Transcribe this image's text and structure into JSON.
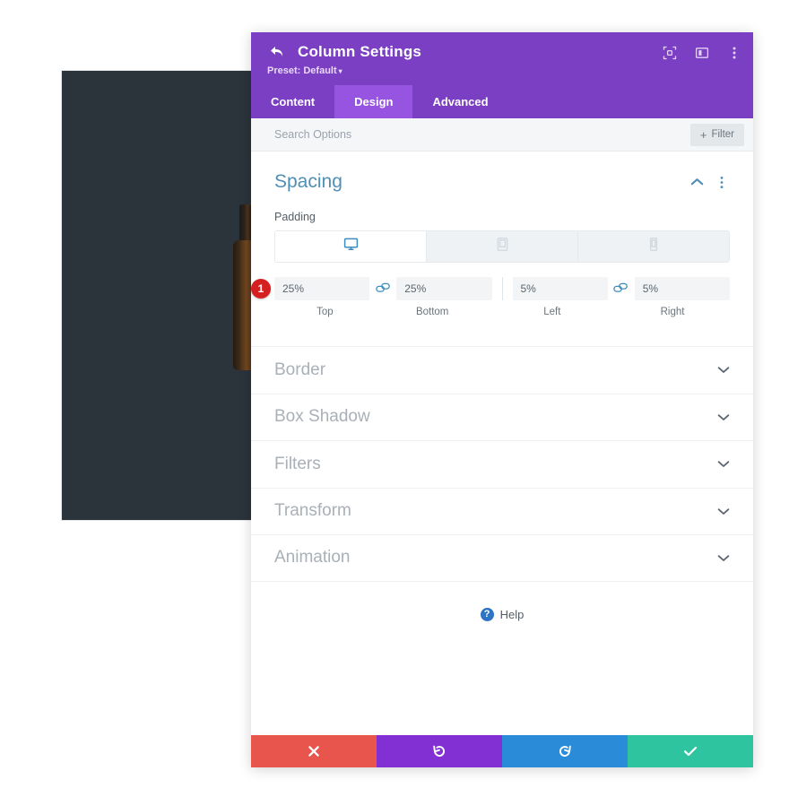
{
  "backdrop": {
    "block_color": "#2b333b",
    "figure_name": "bottle-photo"
  },
  "modal": {
    "title": "Column Settings",
    "preset_label": "Preset: Default",
    "preset_caret": "▾",
    "header_icons": [
      {
        "name": "fullscreen-icon",
        "glyph": "⬚"
      },
      {
        "name": "layout-panel-icon",
        "glyph": "▣"
      },
      {
        "name": "more-vertical-icon",
        "glyph": "⋮"
      }
    ],
    "back_icon": "back-arrow-icon",
    "accent": "#7b3fc4",
    "accent_active": "#9654e0",
    "tabs": [
      {
        "label": "Content",
        "active": false
      },
      {
        "label": "Design",
        "active": true
      },
      {
        "label": "Advanced",
        "active": false
      }
    ]
  },
  "search": {
    "placeholder": "Search Options",
    "value": "",
    "filter_label": "Filter",
    "filter_plus": "+"
  },
  "spacing_section": {
    "title": "Spacing",
    "collapse_icon": "chevron-up-icon",
    "menu_icon": "more-vertical-icon",
    "padding_label": "Padding",
    "devices": [
      {
        "name": "desktop",
        "glyph": "Ὓ5",
        "active": true
      },
      {
        "name": "tablet",
        "glyph": "□",
        "active": false
      },
      {
        "name": "phone",
        "glyph": "▯",
        "active": false
      }
    ],
    "step_badge": "1",
    "fields": [
      {
        "key": "top",
        "value": "25%",
        "label": "Top"
      },
      {
        "key": "bottom",
        "value": "25%",
        "label": "Bottom"
      },
      {
        "key": "left",
        "value": "5%",
        "label": "Left"
      },
      {
        "key": "right",
        "value": "5%",
        "label": "Right"
      }
    ],
    "link_icon": "link-chain-icon"
  },
  "collapsed_sections": [
    {
      "label": "Border"
    },
    {
      "label": "Box Shadow"
    },
    {
      "label": "Filters"
    },
    {
      "label": "Transform"
    },
    {
      "label": "Animation"
    }
  ],
  "help": {
    "label": "Help",
    "icon_glyph": "?"
  },
  "footer": {
    "buttons": [
      {
        "name": "cancel-button",
        "glyph": "✖",
        "color": "#e8554d"
      },
      {
        "name": "undo-button",
        "glyph": "↺",
        "color": "#8230d3"
      },
      {
        "name": "redo-button",
        "glyph": "↻",
        "color": "#2a8cd8"
      },
      {
        "name": "save-button",
        "glyph": "✔",
        "color": "#2ec4a0"
      }
    ]
  }
}
